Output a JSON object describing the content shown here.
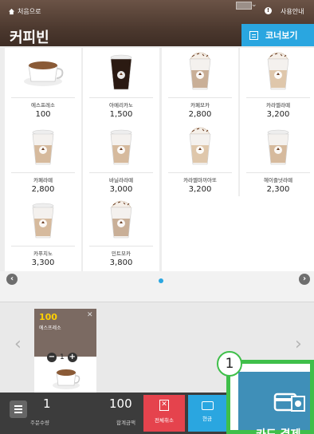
{
  "header": {
    "home_label": "처음으로",
    "guide_label": "사용안내",
    "title": "커피빈",
    "corner_button": "코너보기"
  },
  "products": [
    {
      "name": "에스프레소",
      "price": "100",
      "type": "espresso"
    },
    {
      "name": "아메리카노",
      "price": "1,500",
      "type": "iced-dark"
    },
    {
      "name": "카페모카",
      "price": "2,800",
      "type": "mocha"
    },
    {
      "name": "카라멜라떼",
      "price": "3,200",
      "type": "caramel"
    },
    {
      "name": "카페라떼",
      "price": "2,800",
      "type": "latte"
    },
    {
      "name": "바닐라라떼",
      "price": "3,000",
      "type": "latte"
    },
    {
      "name": "카라멜마끼아또",
      "price": "3,200",
      "type": "caramel"
    },
    {
      "name": "헤이즐넛라떼",
      "price": "2,300",
      "type": "latte"
    },
    {
      "name": "카푸치노",
      "price": "3,300",
      "type": "latte"
    },
    {
      "name": "민트모카",
      "price": "3,800",
      "type": "mocha"
    }
  ],
  "cart": {
    "item_price": "100",
    "item_name": "에스프레소",
    "item_qty": "1"
  },
  "bottom": {
    "qty_value": "1",
    "qty_label": "주문수량",
    "total_value": "100",
    "total_label": "합계금액",
    "cancel_label": "전체취소",
    "cash_label": "현금",
    "card_label": "카드 결제"
  },
  "callout": "1",
  "colors": {
    "accent": "#2aa6e0",
    "header": "#4a372d",
    "cancel": "#e5434d",
    "highlight": "#3fbf4a"
  }
}
